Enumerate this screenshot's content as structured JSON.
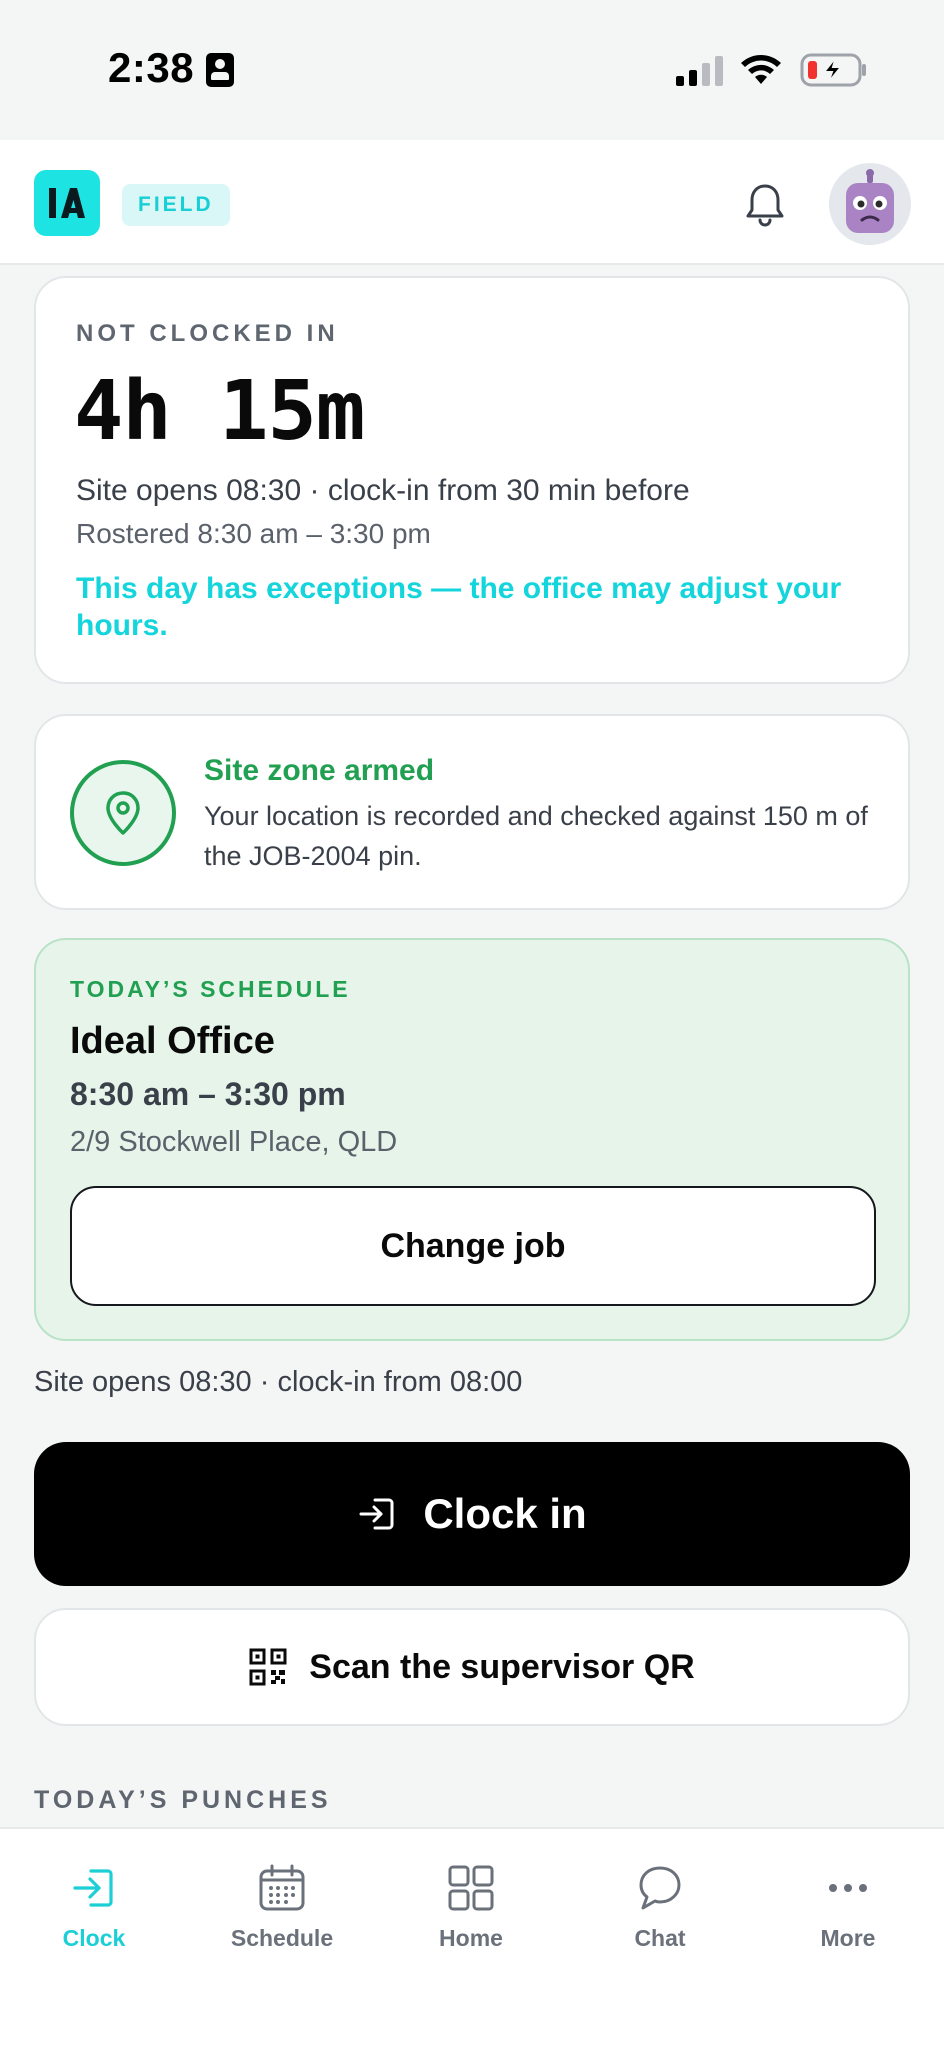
{
  "status_bar": {
    "time": "2:38",
    "battery_state": "charging-low"
  },
  "header": {
    "logo_text": "IA",
    "badge": "FIELD",
    "accent_color": "#1ee3e3"
  },
  "clock_card": {
    "status_label": "NOT CLOCKED IN",
    "countdown": "4h 15m",
    "site_info": "Site opens 08:30 · clock-in from 30 min before",
    "rostered": "Rostered 8:30 am – 3:30 pm",
    "exception_notice": "This day has exceptions — the office may adjust your hours."
  },
  "zone_card": {
    "icon": "location-pin-icon",
    "title": "Site zone armed",
    "description": "Your location is recorded and checked against 150 m of the JOB-2004 pin."
  },
  "schedule_card": {
    "label": "TODAY’S SCHEDULE",
    "job_name": "Ideal Office",
    "time_range": "8:30 am – 3:30 pm",
    "address": "2/9 Stockwell Place, QLD",
    "change_job_label": "Change job"
  },
  "site_opens_note": "Site opens 08:30 · clock-in from 08:00",
  "actions": {
    "clock_in_label": "Clock in",
    "scan_qr_label": "Scan the supervisor QR"
  },
  "punches_heading": "TODAY’S PUNCHES",
  "bottom_nav": {
    "items": [
      {
        "label": "Clock",
        "icon": "clock-in-icon",
        "active": true
      },
      {
        "label": "Schedule",
        "icon": "calendar-icon",
        "active": false
      },
      {
        "label": "Home",
        "icon": "grid-icon",
        "active": false
      },
      {
        "label": "Chat",
        "icon": "chat-bubble-icon",
        "active": false
      },
      {
        "label": "More",
        "icon": "more-dots-icon",
        "active": false
      }
    ]
  },
  "colors": {
    "accent_cyan": "#1ccfd6",
    "success_green": "#21a052",
    "schedule_bg": "#e6f4ea"
  }
}
